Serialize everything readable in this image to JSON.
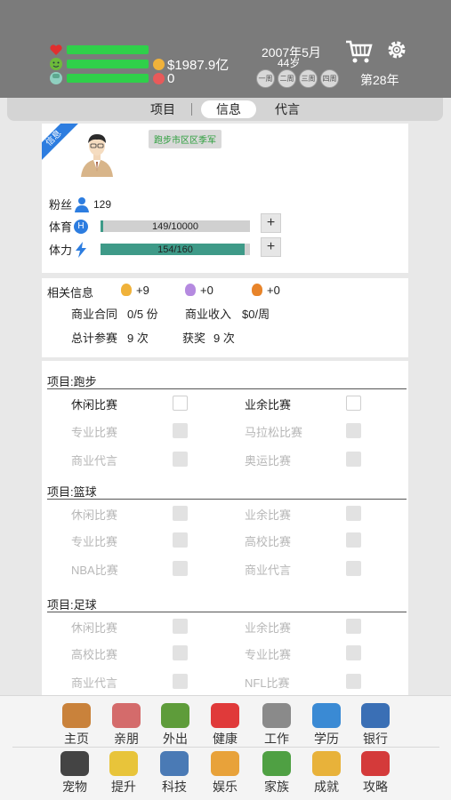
{
  "stats": {
    "money": "$1987.9亿",
    "hearts": "0"
  },
  "calendar": {
    "date": "2007年5月",
    "age": "44岁",
    "weeks": [
      "一周",
      "二周",
      "三周",
      "四周"
    ],
    "year": "第28年"
  },
  "tabs": [
    "项目",
    "信息",
    "代言"
  ],
  "active_tab": "信息",
  "profile": {
    "ribbon": "信息",
    "location": "跑步市区区季军",
    "fans_label": "粉丝",
    "fans_value": "129",
    "sport_label": "体育",
    "sport_value": "149/10000",
    "sport_fraction": 0.0149,
    "stamina_label": "体力",
    "stamina_value": "154/160",
    "stamina_fraction": 0.9625,
    "plus": "+"
  },
  "info": {
    "title": "相关信息",
    "gold": "+9",
    "purple": "+0",
    "orange": "+0",
    "contract_label": "商业合同",
    "contract_value": "0/5 份",
    "income_label": "商业收入",
    "income_value": "$0/周",
    "events_label": "总计参赛",
    "events_value": "9 次",
    "awards_label": "获奖",
    "awards_value": "9 次"
  },
  "projects": [
    {
      "title": "项目:跑步",
      "items": [
        {
          "label": "休闲比赛",
          "enabled": true
        },
        {
          "label": "业余比赛",
          "enabled": true
        },
        {
          "label": "专业比赛",
          "enabled": false
        },
        {
          "label": "马拉松比赛",
          "enabled": false
        },
        {
          "label": "商业代言",
          "enabled": false
        },
        {
          "label": "奥运比赛",
          "enabled": false
        }
      ]
    },
    {
      "title": "项目:篮球",
      "items": [
        {
          "label": "休闲比赛",
          "enabled": false
        },
        {
          "label": "业余比赛",
          "enabled": false
        },
        {
          "label": "专业比赛",
          "enabled": false
        },
        {
          "label": "高校比赛",
          "enabled": false
        },
        {
          "label": "NBA比赛",
          "enabled": false
        },
        {
          "label": "商业代言",
          "enabled": false
        }
      ]
    },
    {
      "title": "项目:足球",
      "items": [
        {
          "label": "休闲比赛",
          "enabled": false
        },
        {
          "label": "业余比赛",
          "enabled": false
        },
        {
          "label": "高校比赛",
          "enabled": false
        },
        {
          "label": "专业比赛",
          "enabled": false
        },
        {
          "label": "商业代言",
          "enabled": false
        },
        {
          "label": "NFL比赛",
          "enabled": false
        }
      ]
    }
  ],
  "nav": [
    {
      "label": "主页",
      "icon": "house-icon",
      "color": "#c9823b"
    },
    {
      "label": "亲朋",
      "icon": "family-icon",
      "color": "#d46b6b"
    },
    {
      "label": "外出",
      "icon": "outing-icon",
      "color": "#5e9c3a"
    },
    {
      "label": "健康",
      "icon": "medical-cross-icon",
      "color": "#e03a3a"
    },
    {
      "label": "工作",
      "icon": "worker-icon",
      "color": "#8a8a8a"
    },
    {
      "label": "学历",
      "icon": "books-icon",
      "color": "#3a8ad4"
    },
    {
      "label": "银行",
      "icon": "bank-icon",
      "color": "#3a6fb5"
    },
    {
      "label": "宠物",
      "icon": "dog-icon",
      "color": "#444444"
    },
    {
      "label": "提升",
      "icon": "lightbulb-icon",
      "color": "#e8c43a"
    },
    {
      "label": "科技",
      "icon": "scientist-icon",
      "color": "#4a7ab5"
    },
    {
      "label": "娱乐",
      "icon": "food-icon",
      "color": "#e8a23a"
    },
    {
      "label": "家族",
      "icon": "tree-icon",
      "color": "#4fa043"
    },
    {
      "label": "成就",
      "icon": "trophy-icon",
      "color": "#e8b23a"
    },
    {
      "label": "攻略",
      "icon": "tips-icon",
      "color": "#d43a3a"
    }
  ]
}
